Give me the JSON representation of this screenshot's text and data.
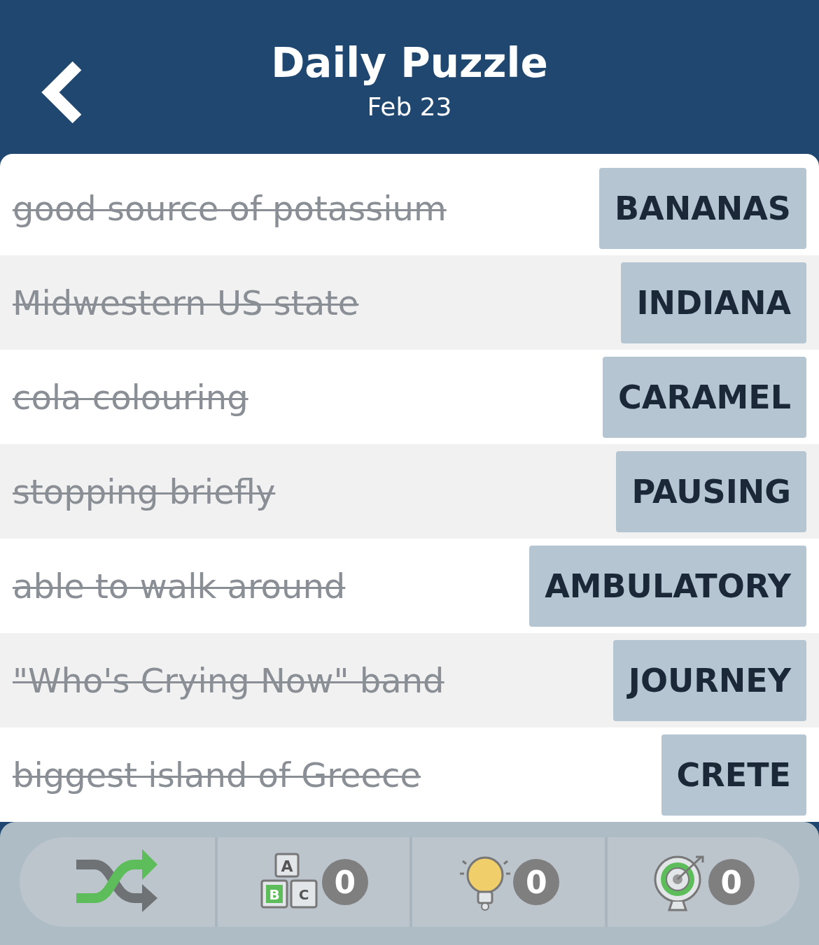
{
  "header": {
    "title": "Daily Puzzle",
    "date": "Feb 23"
  },
  "clues": [
    {
      "clue": "good source of potassium",
      "answer": "BANANAS",
      "solved": true
    },
    {
      "clue": "Midwestern US state",
      "answer": "INDIANA",
      "solved": true
    },
    {
      "clue": "cola colouring",
      "answer": "CARAMEL",
      "solved": true
    },
    {
      "clue": "stopping briefly",
      "answer": "PAUSING",
      "solved": true
    },
    {
      "clue": "able to walk around",
      "answer": "AMBULATORY",
      "solved": true
    },
    {
      "clue": "\"Who's Crying Now\" band",
      "answer": "JOURNEY",
      "solved": true
    },
    {
      "clue": "biggest island of Greece",
      "answer": "CRETE",
      "solved": true
    }
  ],
  "toolbar": [
    {
      "kind": "shuffle"
    },
    {
      "kind": "letters",
      "letters": [
        "A",
        "B",
        "C"
      ],
      "count": "0"
    },
    {
      "kind": "hint",
      "count": "0"
    },
    {
      "kind": "target",
      "count": "0"
    }
  ]
}
